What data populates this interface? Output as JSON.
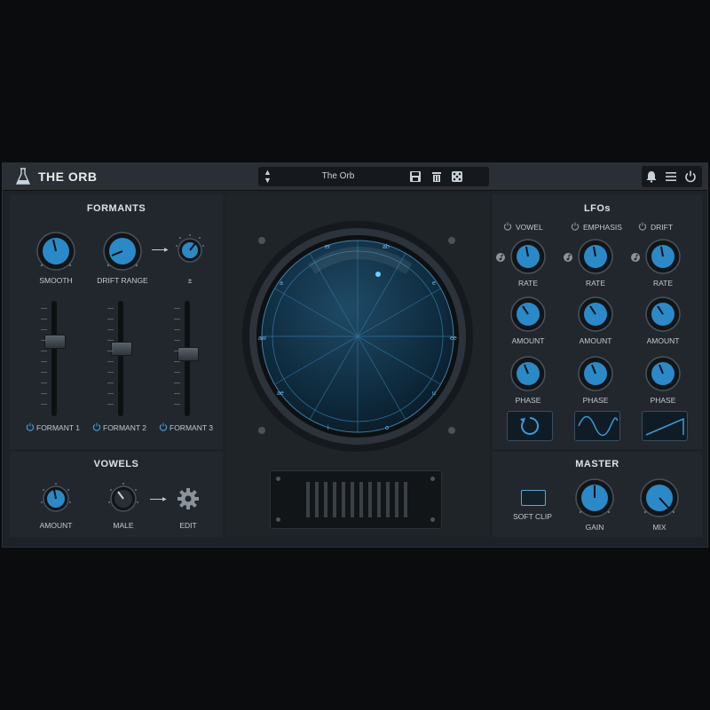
{
  "header": {
    "title": "THE ORB",
    "preset_name": "The Orb"
  },
  "formants": {
    "title": "FORMANTS",
    "knobs": [
      {
        "label": "SMOOTH",
        "value": 0.45
      },
      {
        "label": "DRIFT RANGE",
        "value": 0.35
      },
      {
        "label": "±",
        "value": 0.55
      }
    ],
    "faders": [
      {
        "label": "FORMANT 1",
        "value": 0.35
      },
      {
        "label": "FORMANT 2",
        "value": 0.4
      },
      {
        "label": "FORMANT 3",
        "value": 0.45
      }
    ]
  },
  "vowels": {
    "title": "VOWELS",
    "amount_label": "AMOUNT",
    "amount_value": 0.45,
    "male_label": "MALE",
    "male_value": 0.4,
    "edit_label": "EDIT"
  },
  "orb": {
    "vowel_labels": [
      "er",
      "ah",
      "a",
      "e",
      "aw",
      "ee",
      "ae",
      "u",
      "i",
      "o"
    ]
  },
  "lfos": {
    "title": "LFOs",
    "columns": [
      {
        "name": "VOWEL",
        "rate_label": "RATE",
        "amount_label": "AMOUNT",
        "phase_label": "PHASE",
        "shape": "loop"
      },
      {
        "name": "EMPHASIS",
        "rate_label": "RATE",
        "amount_label": "AMOUNT",
        "phase_label": "PHASE",
        "shape": "sine"
      },
      {
        "name": "DRIFT",
        "rate_label": "RATE",
        "amount_label": "AMOUNT",
        "phase_label": "PHASE",
        "shape": "ramp"
      }
    ]
  },
  "master": {
    "title": "MASTER",
    "soft_clip_label": "SOFT CLIP",
    "gain_label": "GAIN",
    "gain_value": 0.5,
    "mix_label": "MIX",
    "mix_value": 0.7
  },
  "colors": {
    "accent": "#3d9ad6",
    "panel": "#22272d",
    "background": "#0b0c0d"
  }
}
